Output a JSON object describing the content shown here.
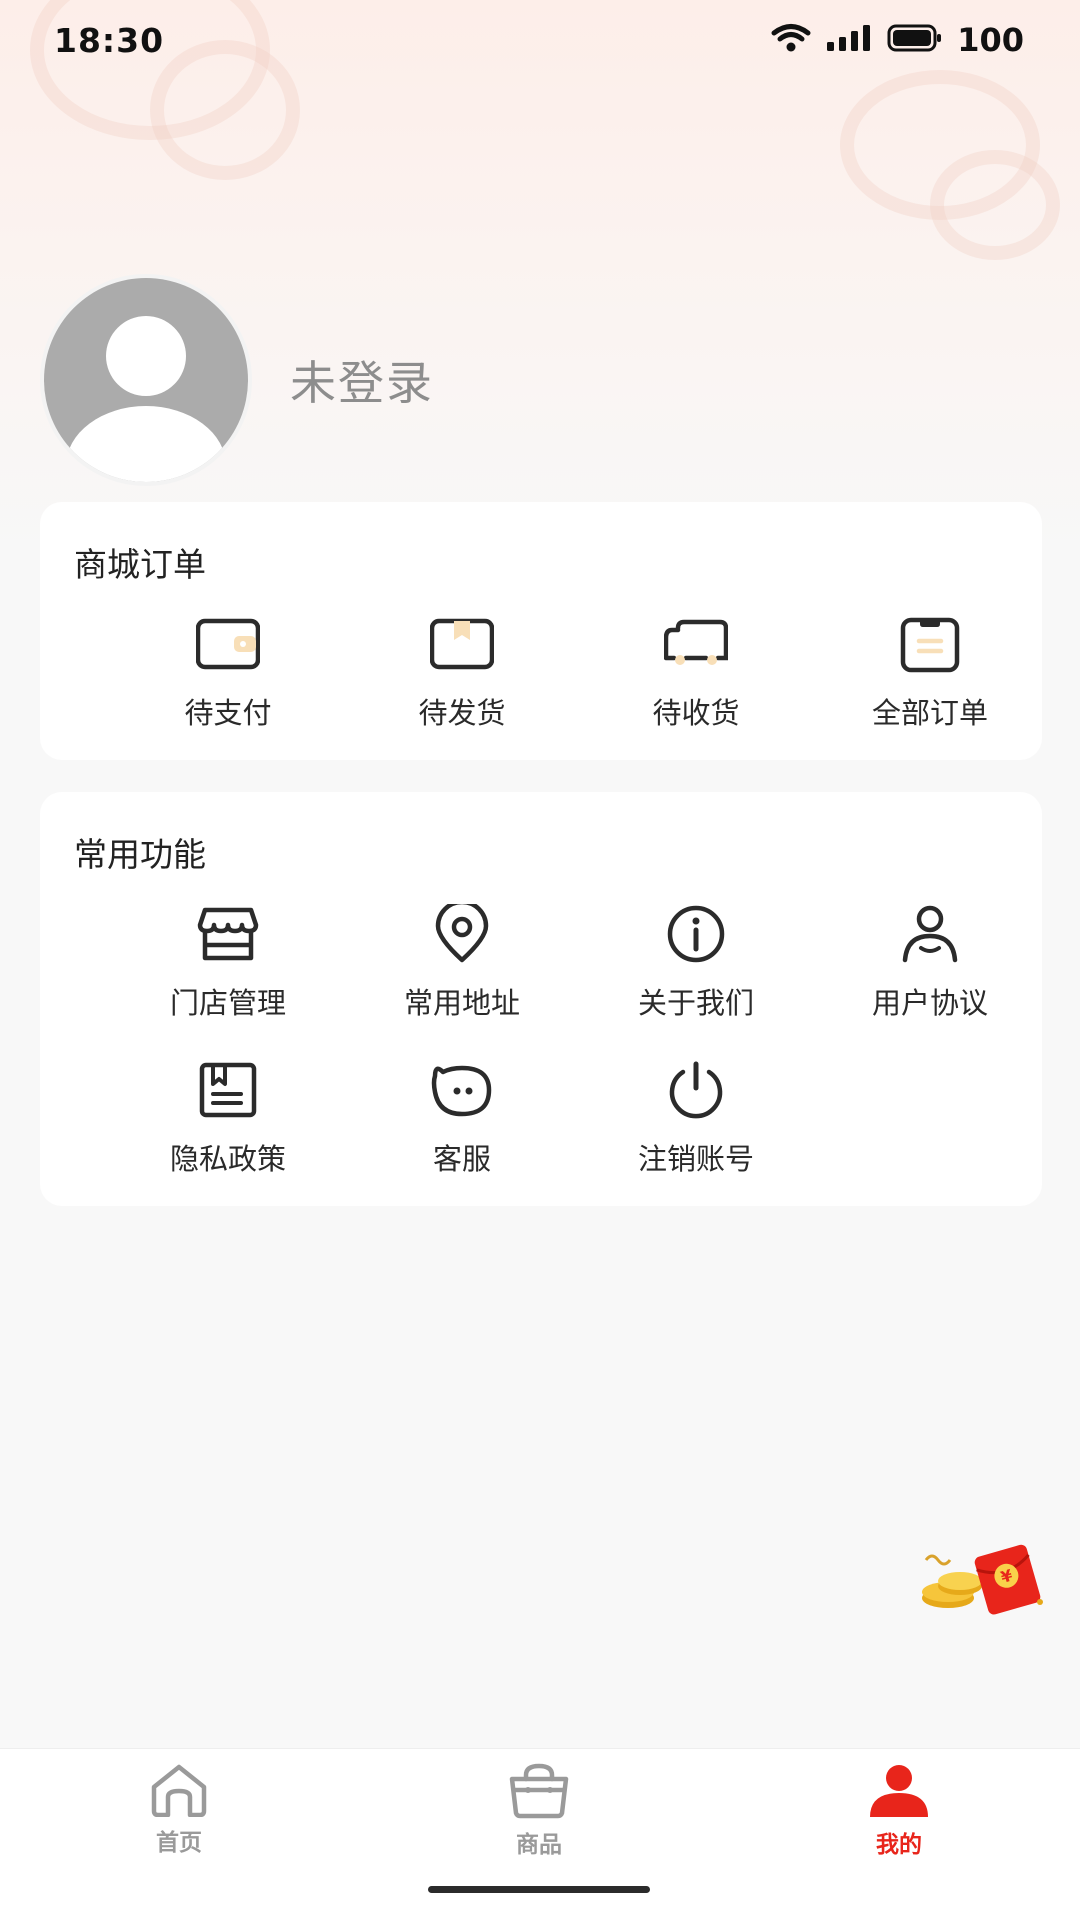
{
  "status_bar": {
    "time": "18:30",
    "battery": "100"
  },
  "profile": {
    "login_status": "未登录"
  },
  "orders": {
    "title": "商城订单",
    "items": [
      {
        "label": "待支付",
        "icon": "wallet-icon"
      },
      {
        "label": "待发货",
        "icon": "package-icon"
      },
      {
        "label": "待收货",
        "icon": "truck-icon"
      },
      {
        "label": "全部订单",
        "icon": "clipboard-icon"
      }
    ]
  },
  "functions": {
    "title": "常用功能",
    "items": [
      {
        "label": "门店管理",
        "icon": "store-icon"
      },
      {
        "label": "常用地址",
        "icon": "location-pin-icon"
      },
      {
        "label": "关于我们",
        "icon": "info-icon"
      },
      {
        "label": "用户协议",
        "icon": "user-icon"
      },
      {
        "label": "隐私政策",
        "icon": "book-icon"
      },
      {
        "label": "客服",
        "icon": "chat-face-icon"
      },
      {
        "label": "注销账号",
        "icon": "power-icon"
      }
    ]
  },
  "floating": {
    "icon": "red-packet-icon"
  },
  "tabbar": {
    "items": [
      {
        "label": "首页",
        "icon": "home-icon",
        "active": false
      },
      {
        "label": "商品",
        "icon": "shopping-bag-icon",
        "active": false
      },
      {
        "label": "我的",
        "icon": "person-icon",
        "active": true
      }
    ]
  },
  "colors": {
    "accent": "#e8251b",
    "inactive": "#9a9a9a",
    "icon_stroke": "#2b2b2b",
    "icon_highlight": "#f8dfb8"
  }
}
